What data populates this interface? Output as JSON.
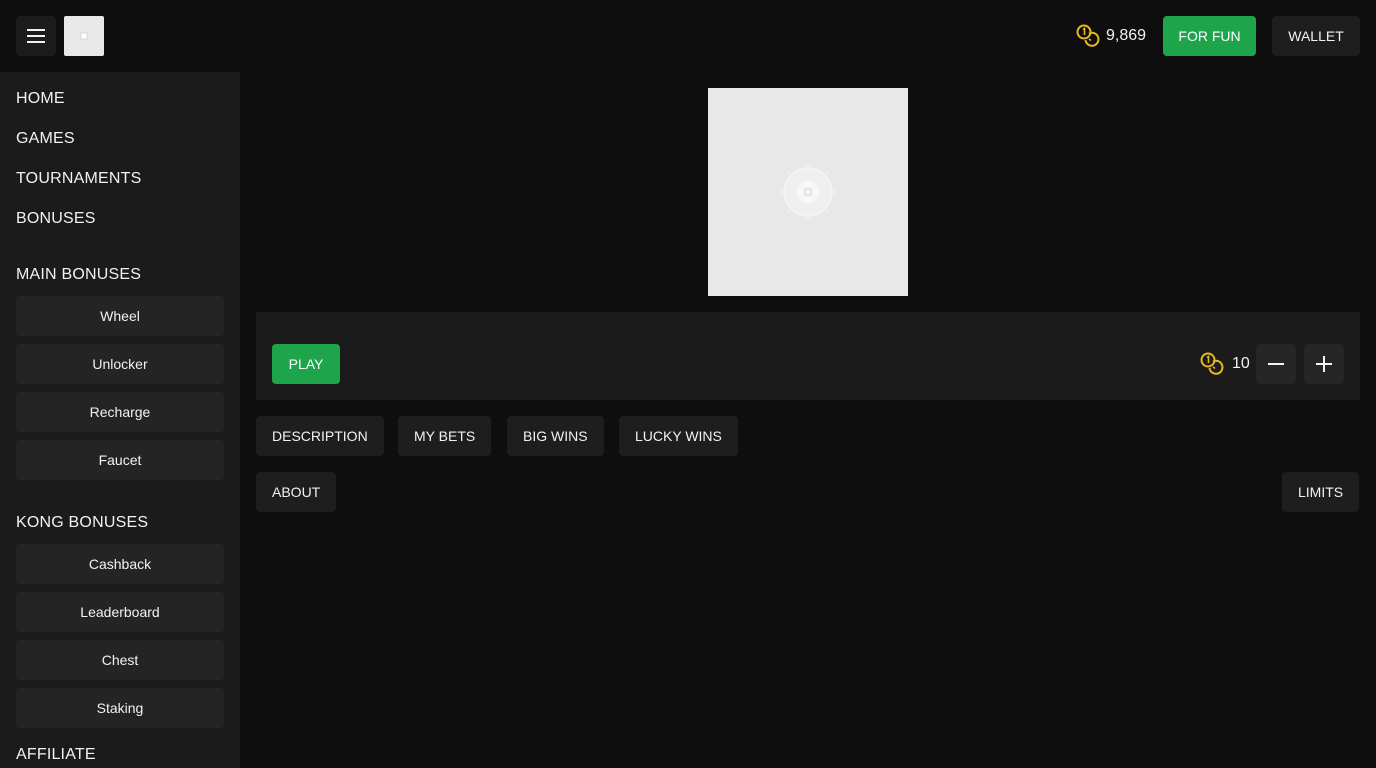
{
  "header": {
    "menu_icon": "hamburger-icon",
    "balance_icon": "coins-icon",
    "balance": "9,869",
    "for_fun_label": "FOR FUN",
    "wallet_label": "WALLET"
  },
  "sidebar": {
    "nav": [
      "HOME",
      "GAMES",
      "TOURNAMENTS",
      "BONUSES"
    ],
    "main_bonuses_title": "MAIN BONUSES",
    "main_bonuses": [
      "Wheel",
      "Unlocker",
      "Recharge",
      "Faucet"
    ],
    "kong_bonuses_title": "KONG BONUSES",
    "kong_bonuses": [
      "Cashback",
      "Leaderboard",
      "Chest",
      "Staking"
    ],
    "affiliate_title": "AFFILIATE"
  },
  "controls": {
    "play_label": "PLAY",
    "bet_icon": "coins-icon",
    "bet_amount": "10",
    "minus_icon": "minus-icon",
    "plus_icon": "plus-icon"
  },
  "tabs": [
    "DESCRIPTION",
    "MY BETS",
    "BIG WINS",
    "LUCKY WINS"
  ],
  "about_label": "ABOUT",
  "limits_label": "LIMITS",
  "colors": {
    "accent_green": "#1ea54c",
    "coin_gold": "#e8b81e",
    "background": "#0e0e0e",
    "sidebar": "#1b1b1b"
  }
}
